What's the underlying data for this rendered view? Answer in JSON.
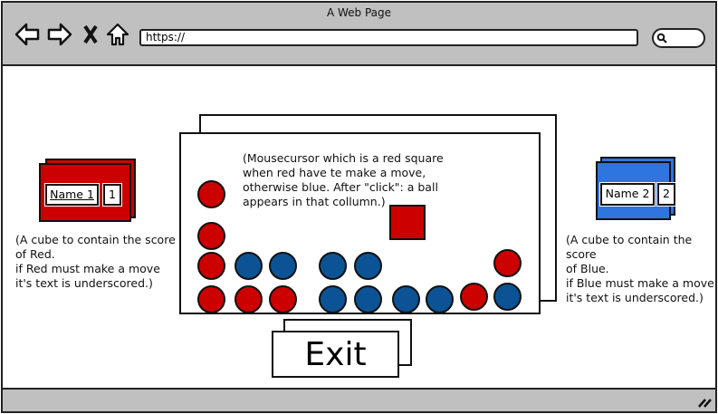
{
  "browser": {
    "title": "A Web Page",
    "url": "https://",
    "icons": [
      "back-arrow-icon",
      "forward-arrow-icon",
      "close-x-icon",
      "home-icon",
      "search-icon",
      "resize-grip-icon"
    ]
  },
  "red_player": {
    "name": "Name 1",
    "score": "1",
    "color": "#cc0000",
    "note": "(A cube to contain the score\nof Red.\nif Red must make a move\nit's text is underscored.)",
    "underlined": true
  },
  "blue_player": {
    "name": "Name 2",
    "score": "2",
    "color": "#2e75e0",
    "note": "(A cube to contain the score\nof Blue.\nif Blue must make a move\nit's text is underscored.)",
    "underlined": false
  },
  "board": {
    "note": "(Mousecursor which is a red square\nwhen red have te make a move,\notherwise blue. After \"click\": a ball\nappears in that collumn.)",
    "cursor_color": "#cc0000",
    "ball_colors": {
      "red": "#cc0000",
      "blue": "#0b5394"
    },
    "columns": [
      [
        "red",
        "red",
        "red",
        "red"
      ],
      [
        "red",
        "blue"
      ],
      [
        "red",
        "blue"
      ],
      [
        "blue",
        "blue"
      ],
      [
        "blue",
        "blue"
      ],
      [
        "blue"
      ],
      [
        "blue"
      ],
      [
        "red"
      ],
      [
        "blue",
        "red"
      ]
    ]
  },
  "exit_label": "Exit"
}
